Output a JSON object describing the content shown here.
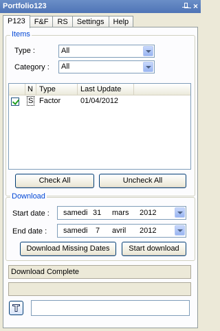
{
  "window": {
    "title": "Portfolio123",
    "pin_glyph": "↑",
    "close_glyph": "×"
  },
  "tabs": [
    "P123",
    "F&F",
    "RS",
    "Settings",
    "Help"
  ],
  "items": {
    "legend": "Items",
    "type_label": "Type :",
    "type_value": "All",
    "category_label": "Category :",
    "category_value": "All",
    "columns": [
      "N",
      "Type",
      "Last Update"
    ],
    "rows": [
      {
        "checked": true,
        "n": "S",
        "type": "Factor",
        "last_update": "01/04/2012"
      }
    ],
    "check_all": "Check All",
    "uncheck_all": "Uncheck All"
  },
  "download": {
    "legend": "Download",
    "start_label": "Start date :",
    "start_day_name": "samedi",
    "start_day": "31",
    "start_month": "mars",
    "start_year": "2012",
    "end_label": "End date :",
    "end_day_name": "samedi",
    "end_day": "7",
    "end_month": "avril",
    "end_year": "2012",
    "missing_button": "Download Missing Dates",
    "start_button": "Start download"
  },
  "status": {
    "message": "Download Complete",
    "secondary": ""
  },
  "search": {
    "value": ""
  },
  "icons": {
    "filter": "funnel-icon",
    "dropdown": "chevron-down-icon"
  },
  "colors": {
    "titlebar": "#4f74b6",
    "legend": "#0046d5",
    "check": "#21a121"
  }
}
